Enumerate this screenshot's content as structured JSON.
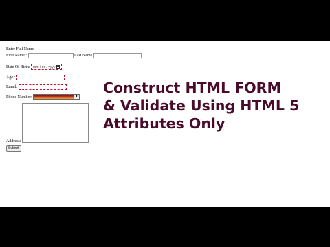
{
  "form": {
    "heading": "Enter Full Name",
    "first_name_label": "First Name :",
    "last_name_label": "Last Name",
    "dob_label": "Date Of Birth:",
    "dob_placeholder": "mm / dd / yyyy",
    "age_label": "Age :",
    "email_label": "Email:",
    "phone_label": "Phone Number:",
    "address_label": "Address:",
    "submit_label": "Submit",
    "phone_color_value": "#b52a1a",
    "stepper_glyph": "⬍"
  },
  "headline": {
    "line1": "Construct HTML FORM",
    "line2": "& Validate Using HTML 5",
    "line3": "Attributes Only"
  },
  "colors": {
    "headline": "#4a0a2a",
    "invalid_border": "#c0102a",
    "letterbox": "#000000"
  }
}
